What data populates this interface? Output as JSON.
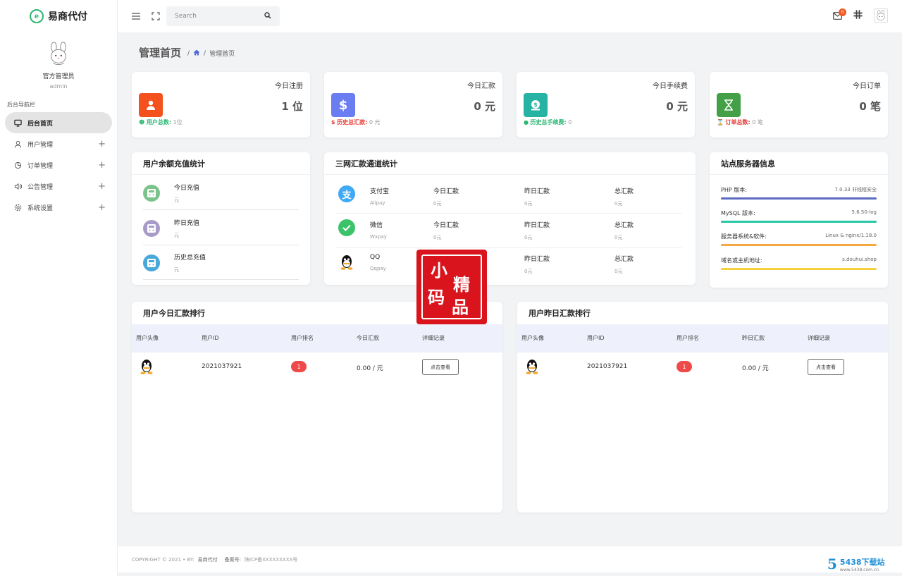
{
  "brand": {
    "name": "易商代付",
    "accent": "#2bb673"
  },
  "profile": {
    "name": "官方管理员",
    "role": "admin"
  },
  "sidebar": {
    "section_title": "后台导航栏",
    "items": [
      {
        "label": "后台首页",
        "icon": "monitor-icon",
        "active": true
      },
      {
        "label": "用户管理",
        "icon": "user-icon",
        "expandable": true
      },
      {
        "label": "订单管理",
        "icon": "pie-chart-icon",
        "expandable": true
      },
      {
        "label": "公告管理",
        "icon": "speaker-icon",
        "expandable": true
      },
      {
        "label": "系统设置",
        "icon": "gear-icon",
        "expandable": true
      }
    ]
  },
  "topbar": {
    "search_placeholder": "Search",
    "mail_count": "0"
  },
  "page": {
    "title": "管理首页",
    "breadcrumb_sep": "/",
    "breadcrumb_current": "管理首页"
  },
  "stats": [
    {
      "label": "今日注册",
      "value": "1 位",
      "foot_label": "用户总数:",
      "foot_value": "1位",
      "icon": "user-icon",
      "color": "#f4511e",
      "foot_color": "#2bb673"
    },
    {
      "label": "今日汇款",
      "value": "0 元",
      "foot_label": "历史总汇款:",
      "foot_value": "0 元",
      "icon": "dollar-icon",
      "color": "#6a7ef1",
      "foot_color": "#e53935"
    },
    {
      "label": "今日手续费",
      "value": "0 元",
      "foot_label": "历史总手续费:",
      "foot_value": "0",
      "icon": "money-icon",
      "color": "#26b3a3",
      "foot_color": "#2bb673"
    },
    {
      "label": "今日订单",
      "value": "0 笔",
      "foot_label": "订单总数:",
      "foot_value": "0 笔",
      "icon": "hourglass-icon",
      "color": "#43a047",
      "foot_color": "#e53935"
    }
  ],
  "recharge": {
    "title": "用户余额充值统计",
    "rows": [
      {
        "label": "今日充值",
        "unit": "元",
        "color": "#7cc38b"
      },
      {
        "label": "昨日充值",
        "unit": "元",
        "color": "#a99bc8"
      },
      {
        "label": "历史总充值",
        "unit": "元",
        "color": "#4aa7d9"
      }
    ]
  },
  "channels": {
    "title": "三网汇款通道统计",
    "rows": [
      {
        "name": "支付宝",
        "sub": "Alipay",
        "c1": "今日汇款",
        "v1": "0元",
        "c2": "昨日汇款",
        "v2": "0元",
        "c3": "总汇款",
        "v3": "0元",
        "icon": "alipay-icon",
        "color": "#3fa9f5"
      },
      {
        "name": "微信",
        "sub": "Wxpay",
        "c1": "今日汇款",
        "v1": "0元",
        "c2": "昨日汇款",
        "v2": "0元",
        "c3": "总汇款",
        "v3": "0元",
        "icon": "wechat-icon",
        "color": "#3cc36a"
      },
      {
        "name": "QQ",
        "sub": "Qqpay",
        "c2": "昨日汇款",
        "v2": "0元",
        "c3": "总汇款",
        "v3": "0元",
        "icon": "qq-icon",
        "color": "#222"
      }
    ]
  },
  "server": {
    "title": "站点服务器信息",
    "rows": [
      {
        "label": "PHP 版本:",
        "value": "7.0.33 非线程安全",
        "color": "#5c6bc0"
      },
      {
        "label": "MySQL 版本:",
        "value": "5.6.50-log",
        "color": "#26c6a6"
      },
      {
        "label": "服务器系统&软件:",
        "value": "Linux & nginx/1.18.0",
        "color": "#f5a742"
      },
      {
        "label": "域名或主机地址:",
        "value": "s.douhui.shop",
        "color": "#f4d03f"
      }
    ]
  },
  "rank_today": {
    "title": "用户今日汇款排行",
    "headers": [
      "用户头像",
      "用户ID",
      "用户排名",
      "今日汇款",
      "详细记录"
    ],
    "rows": [
      {
        "id": "2021037921",
        "rank": "1",
        "amount": "0.00 / 元",
        "action": "点击查看"
      }
    ]
  },
  "rank_yesterday": {
    "title": "用户昨日汇款排行",
    "headers": [
      "用户头像",
      "用户ID",
      "用户排名",
      "昨日汇款",
      "详细记录"
    ],
    "rows": [
      {
        "id": "2021037921",
        "rank": "1",
        "amount": "0.00 / 元",
        "action": "点击查看"
      }
    ]
  },
  "footer": {
    "copyright": "COPYRIGHT © 2021 • BY:",
    "by": "易商代付",
    "icp_label": "备案号:",
    "icp": "陕ICP备XXXXXXXXX号"
  },
  "seal": {
    "chars": [
      "小",
      "精",
      "码",
      "品"
    ]
  },
  "watermark": {
    "num": "5",
    "title": "5438下载站",
    "url": "www.5438.com.cn"
  }
}
